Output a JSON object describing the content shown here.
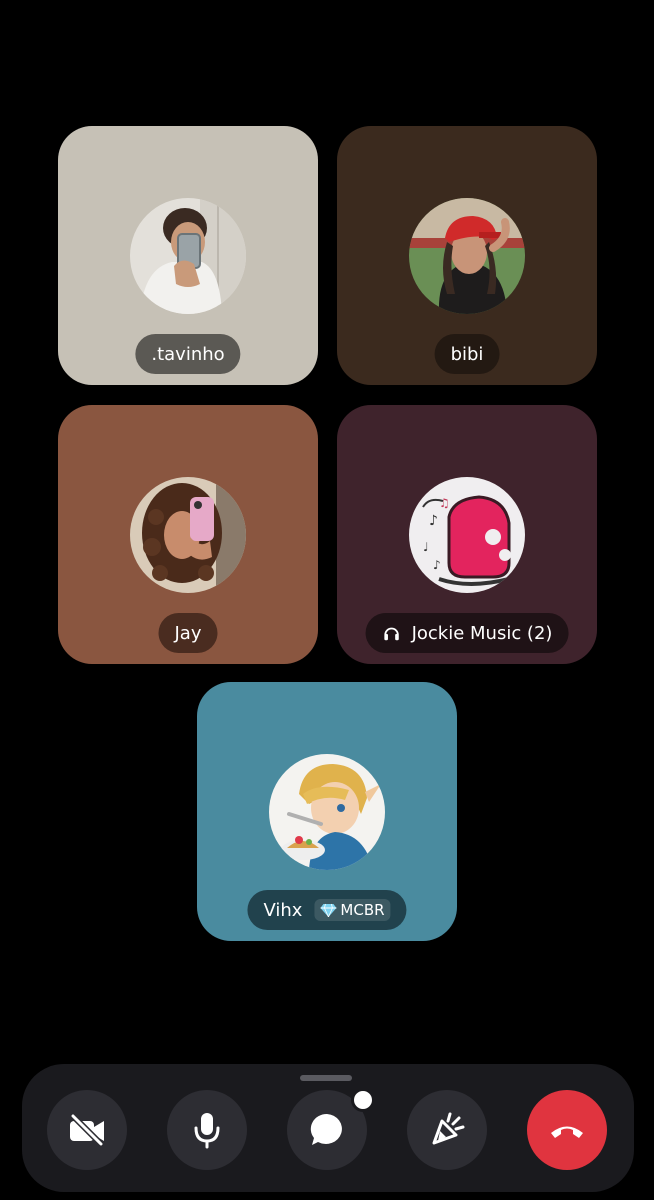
{
  "participants": [
    {
      "name": ".tavinho",
      "tile_color": "#c6c1b6",
      "plate_color": "#5b5954"
    },
    {
      "name": "bibi",
      "tile_color": "#3b2a1e",
      "plate_color": "#231912"
    },
    {
      "name": "Jay",
      "tile_color": "#8a5640",
      "plate_color": "#4a2c20"
    },
    {
      "name": "Jockie Music (2)",
      "tile_color": "#3f232c",
      "plate_color": "#1f1216",
      "is_bot": true
    },
    {
      "name": "Vihx",
      "tile_color": "#4a8b9f",
      "plate_color": "#21424d",
      "tag": "MCBR"
    }
  ],
  "controls": {
    "camera": {
      "icon": "camera-off-icon",
      "state": "off"
    },
    "microphone": {
      "icon": "microphone-icon"
    },
    "chat": {
      "icon": "chat-bubble-icon",
      "unread_indicator": true
    },
    "activities": {
      "icon": "activity-rocket-icon"
    },
    "end_call": {
      "icon": "hang-up-icon",
      "color": "#e0343f"
    }
  }
}
